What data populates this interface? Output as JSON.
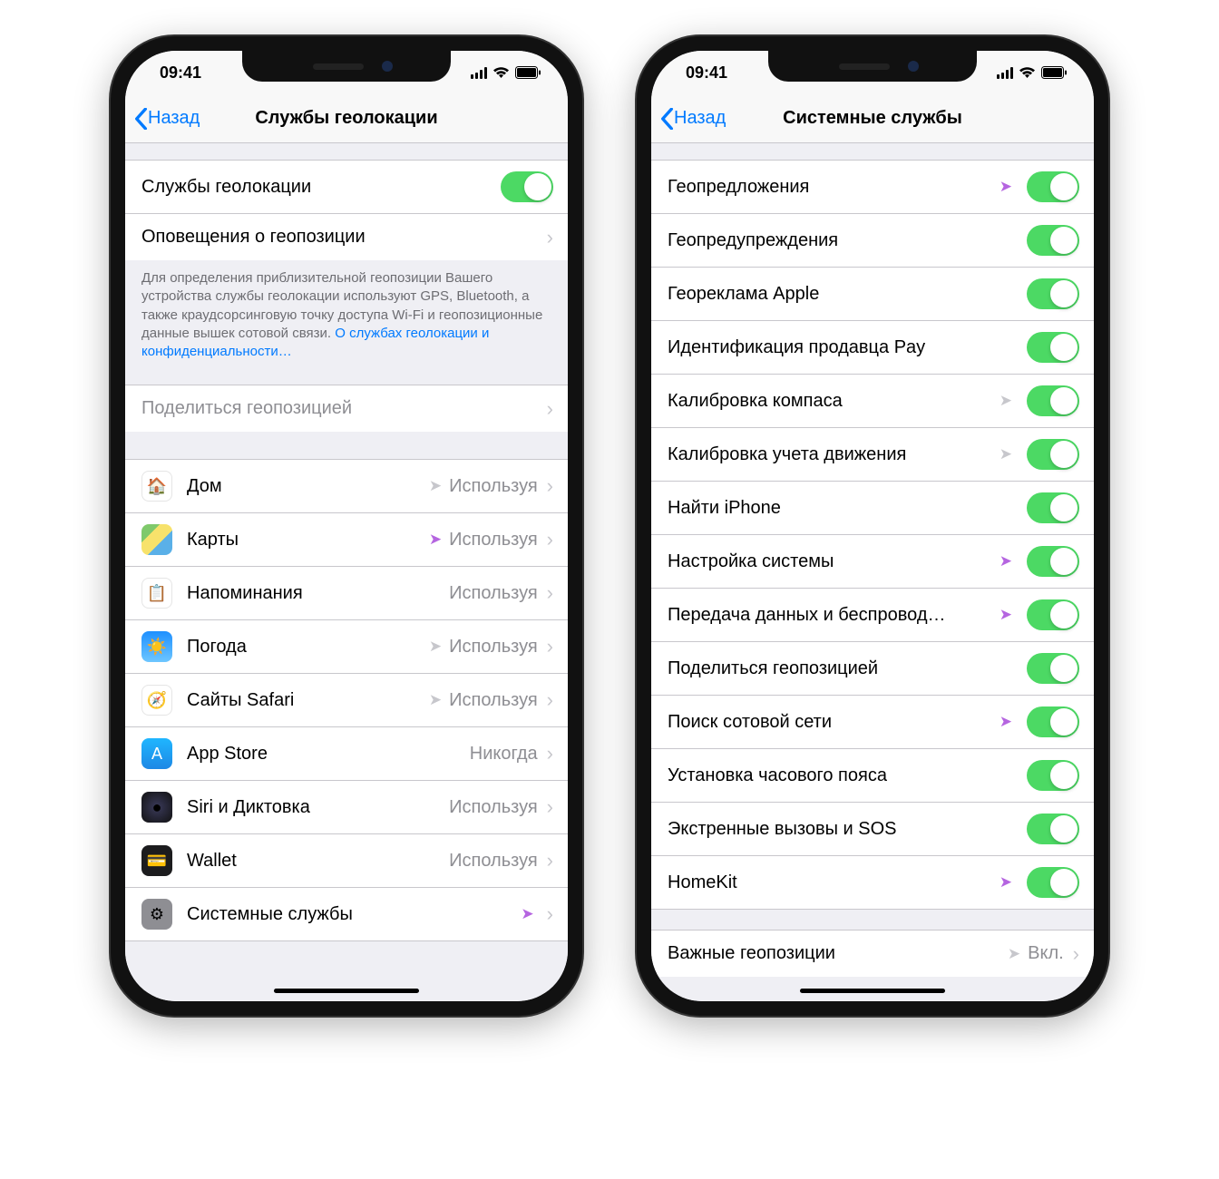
{
  "statusbar": {
    "time": "09:41"
  },
  "phone1": {
    "back": "Назад",
    "title": "Службы геолокации",
    "rows": {
      "locationServices": "Службы геолокации",
      "locationAlerts": "Оповещения о геопозиции",
      "shareLocation": "Поделиться геопозицией"
    },
    "footer": {
      "text": "Для определения приблизительной геопозиции Вашего устройства службы геолокации используют GPS, Bluetooth, а также краудсорсинговую точку доступа Wi-Fi и геопозиционные данные вышек сотовой связи. ",
      "link": "О службах геолокации и конфиденциальности…"
    },
    "apps": [
      {
        "name": "Дом",
        "status": "Используя",
        "arrow": "gray",
        "iconClass": "ic-home"
      },
      {
        "name": "Карты",
        "status": "Используя",
        "arrow": "purple",
        "iconClass": "ic-maps"
      },
      {
        "name": "Напоминания",
        "status": "Используя",
        "arrow": "",
        "iconClass": "ic-rem"
      },
      {
        "name": "Погода",
        "status": "Используя",
        "arrow": "gray",
        "iconClass": "ic-weather"
      },
      {
        "name": "Сайты Safari",
        "status": "Используя",
        "arrow": "gray",
        "iconClass": "ic-safari"
      },
      {
        "name": "App Store",
        "status": "Никогда",
        "arrow": "",
        "iconClass": "ic-appstore"
      },
      {
        "name": "Siri и Диктовка",
        "status": "Используя",
        "arrow": "",
        "iconClass": "ic-siri"
      },
      {
        "name": "Wallet",
        "status": "Используя",
        "arrow": "",
        "iconClass": "ic-wallet"
      },
      {
        "name": "Системные службы",
        "status": "",
        "arrow": "purple",
        "iconClass": "ic-sys"
      }
    ]
  },
  "phone2": {
    "back": "Назад",
    "title": "Системные службы",
    "services": [
      {
        "name": "Геопредложения",
        "arrow": "purple"
      },
      {
        "name": "Геопредупреждения",
        "arrow": ""
      },
      {
        "name": "Геореклама Apple",
        "arrow": ""
      },
      {
        "name": "Идентификация продавца Pay",
        "arrow": ""
      },
      {
        "name": "Калибровка компаса",
        "arrow": "gray"
      },
      {
        "name": "Калибровка учета движения",
        "arrow": "gray"
      },
      {
        "name": "Найти iPhone",
        "arrow": ""
      },
      {
        "name": "Настройка системы",
        "arrow": "purple"
      },
      {
        "name": "Передача данных и беспровод…",
        "arrow": "purple"
      },
      {
        "name": "Поделиться геопозицией",
        "arrow": ""
      },
      {
        "name": "Поиск сотовой сети",
        "arrow": "purple"
      },
      {
        "name": "Установка часового пояса",
        "arrow": ""
      },
      {
        "name": "Экстренные вызовы и SOS",
        "arrow": ""
      },
      {
        "name": "HomeKit",
        "arrow": "purple"
      }
    ],
    "significant": {
      "label": "Важные геопозиции",
      "value": "Вкл.",
      "arrow": "gray"
    }
  }
}
